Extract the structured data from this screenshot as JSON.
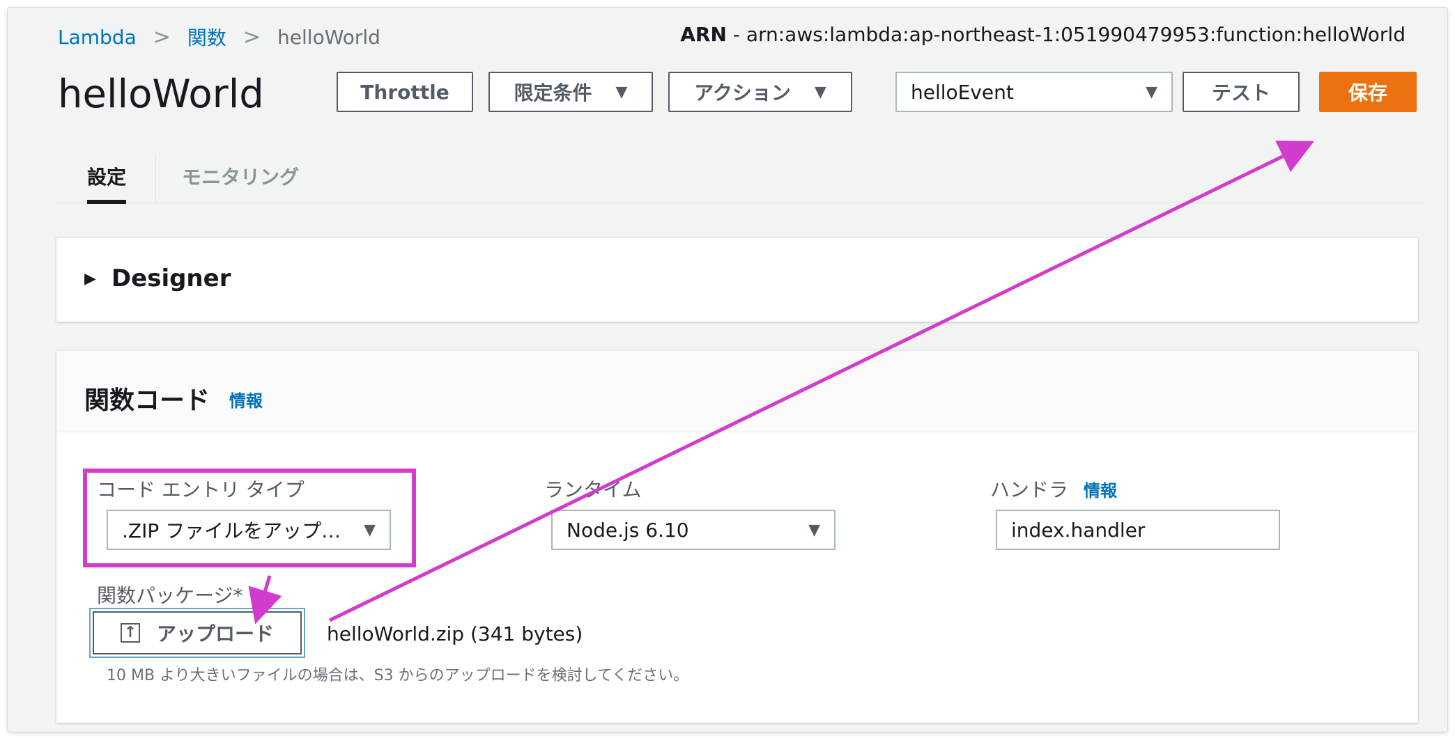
{
  "breadcrumb": {
    "root": "Lambda",
    "functions": "関数",
    "current": "helloWorld"
  },
  "arn": {
    "label": "ARN",
    "value": " - arn:aws:lambda:ap-northeast-1:051990479953:function:helloWorld"
  },
  "page": {
    "title": "helloWorld"
  },
  "toolbar": {
    "throttle": "Throttle",
    "qualifiers": "限定条件",
    "actions": "アクション",
    "test_event": "helloEvent",
    "test": "テスト",
    "save": "保存"
  },
  "tabs": {
    "settings": "設定",
    "monitoring": "モニタリング"
  },
  "designer": {
    "title": "Designer"
  },
  "code": {
    "title": "関数コード",
    "info": "情報",
    "entry_type_label": "コード エントリ タイプ",
    "entry_type_value": ".ZIP ファイルをアップ…",
    "runtime_label": "ランタイム",
    "runtime_value": "Node.js 6.10",
    "handler_label": "ハンドラ",
    "handler_info": "情報",
    "handler_value": "index.handler",
    "package_label": "関数パッケージ*",
    "upload_button": "アップロード",
    "uploaded_file": "helloWorld.zip (341 bytes)",
    "upload_help": "10 MB より大きいファイルの場合は、S3 からのアップロードを検討してください。"
  },
  "colors": {
    "accent": "#ec7211",
    "link": "#0073bb",
    "annotation": "#d13ccc"
  },
  "icons": {
    "caret": "caret-down-icon",
    "expand": "triangle-right-icon",
    "upload": "upload-icon"
  }
}
